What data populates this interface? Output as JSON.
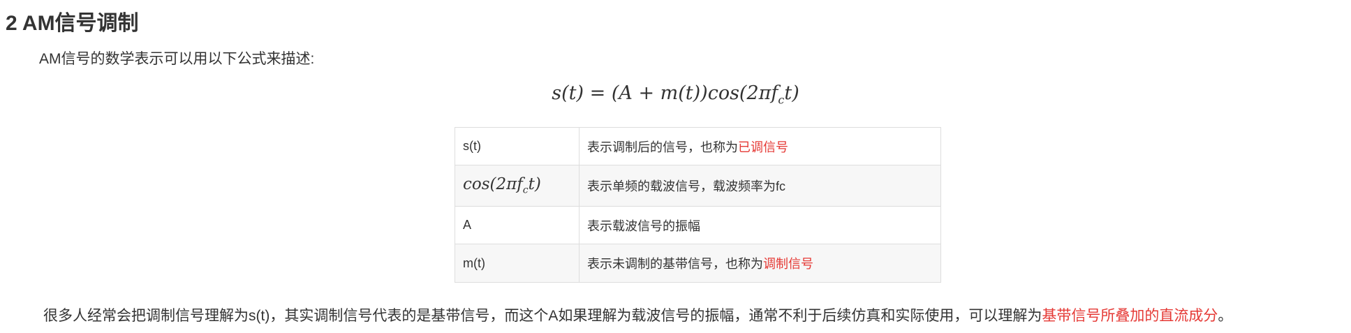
{
  "heading": "2 AM信号调制",
  "intro": "AM信号的数学表示可以用以下公式来描述:",
  "formula": {
    "lhs": "s(t)",
    "eq": " = ",
    "rhs_pre": "(A + m(t))cos(2πf",
    "rhs_sub": "c",
    "rhs_post": "t)"
  },
  "table": {
    "rows": [
      {
        "term": "s(t)",
        "desc": "表示调制后的信号，也称为",
        "highlight": "已调信号"
      },
      {
        "term_pre": "cos(2πf",
        "term_sub": "c",
        "term_post": "t)",
        "desc": "表示单频的载波信号，载波频率为fc",
        "highlight": ""
      },
      {
        "term": "A",
        "desc": "表示载波信号的振幅",
        "highlight": ""
      },
      {
        "term": "m(t)",
        "desc": "表示未调制的基带信号，也称为",
        "highlight": "调制信号"
      }
    ]
  },
  "summary": {
    "text": "很多人经常会把调制信号理解为s(t)，其实调制信号代表的是基带信号，而这个A如果理解为载波信号的振幅，通常不利于后续仿真和实际使用，可以理解为",
    "highlight": "基带信号所叠加的直流成分",
    "end": "。"
  },
  "colors": {
    "text": "#333333",
    "highlight": "#e53935",
    "table_border": "#dddddd",
    "table_stripe": "#f7f7f7"
  }
}
